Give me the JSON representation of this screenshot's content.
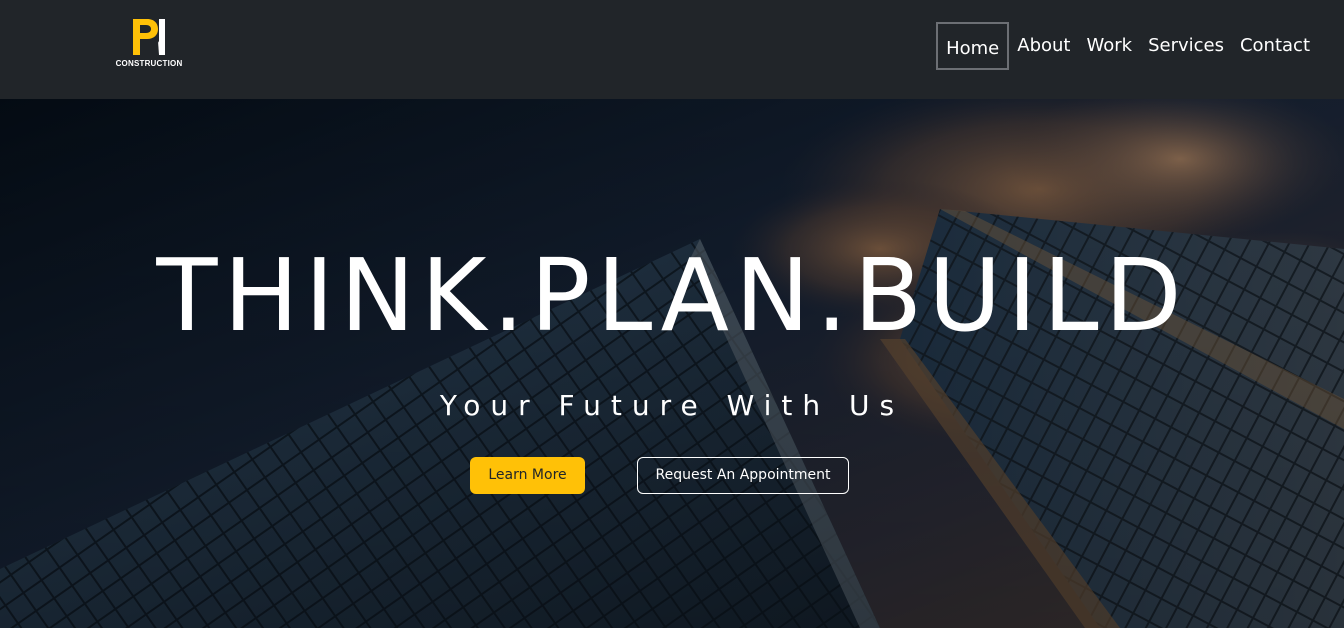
{
  "brand": {
    "logo_text": "CONSTRUCTION",
    "logo_mark": "PN",
    "accent_color": "#ffc107"
  },
  "nav": {
    "items": [
      {
        "label": "Home",
        "active": true
      },
      {
        "label": "About",
        "active": false
      },
      {
        "label": "Work",
        "active": false
      },
      {
        "label": "Services",
        "active": false
      },
      {
        "label": "Contact",
        "active": false
      }
    ]
  },
  "hero": {
    "title": "THINK.PLAN.BUILD",
    "subtitle": "Your Future With Us",
    "primary_button": "Learn More",
    "secondary_button": "Request An Appointment",
    "background": "low-angle-skyscrapers-sunset-sky-image"
  }
}
